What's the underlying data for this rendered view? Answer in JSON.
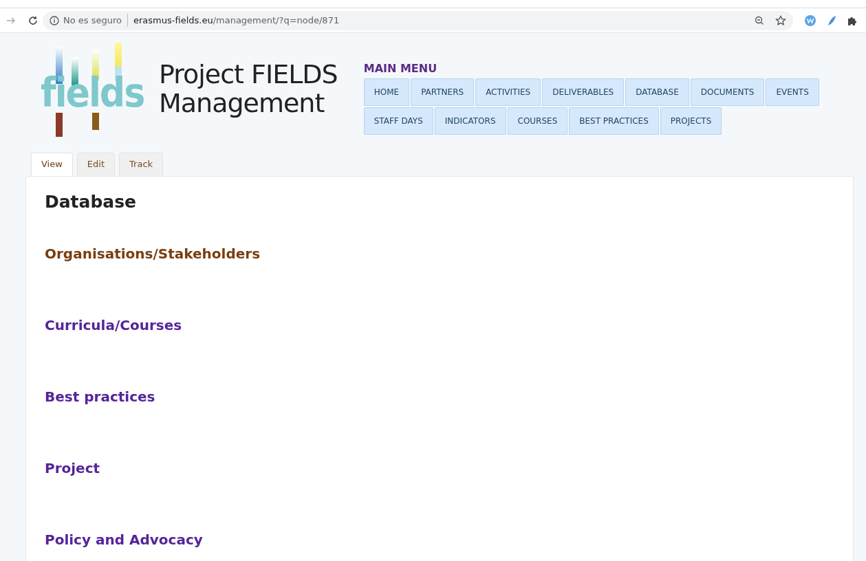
{
  "browser": {
    "security": "No es seguro",
    "url_host": "erasmus-fields.eu",
    "url_path": "/management/?q=node/871"
  },
  "site": {
    "logo_text": "fields",
    "title_line1": "Project FIELDS",
    "title_line2": "Management"
  },
  "main_menu": {
    "title": "MAIN MENU",
    "rows": [
      [
        "HOME",
        "PARTNERS",
        "ACTIVITIES",
        "DELIVERABLES",
        "DATABASE",
        "DOCUMENTS",
        "EVENTS"
      ],
      [
        "STAFF DAYS",
        "INDICATORS",
        "COURSES",
        "BEST PRACTICES",
        "PROJECTS"
      ]
    ]
  },
  "tabs": [
    {
      "label": "View",
      "selected": true
    },
    {
      "label": "Edit",
      "selected": false
    },
    {
      "label": "Track",
      "selected": false
    }
  ],
  "page": {
    "title": "Database",
    "links": [
      {
        "label": "Organisations/Stakeholders",
        "visited": true
      },
      {
        "label": "Curricula/Courses",
        "visited": false
      },
      {
        "label": "Best practices",
        "visited": false
      },
      {
        "label": "Project",
        "visited": false
      },
      {
        "label": "Policy and Advocacy",
        "visited": false
      }
    ]
  }
}
